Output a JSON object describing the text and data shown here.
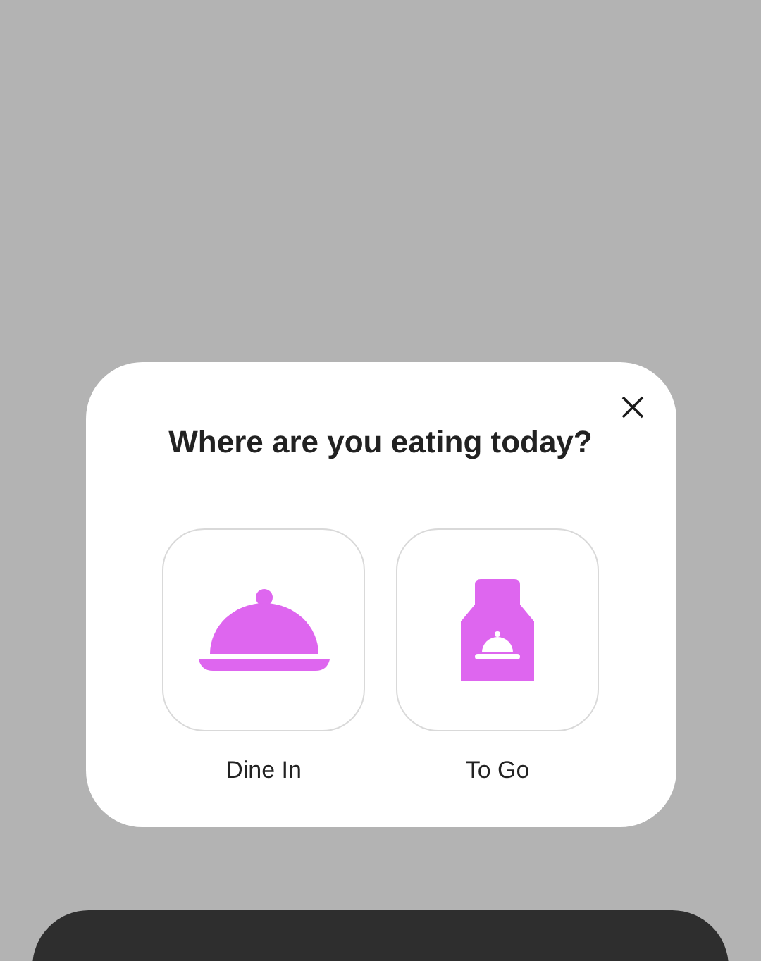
{
  "dialog": {
    "title": "Where are you eating today?",
    "options": [
      {
        "label": "Dine In",
        "kind": "dine_in"
      },
      {
        "label": "To Go",
        "kind": "to_go"
      }
    ]
  }
}
